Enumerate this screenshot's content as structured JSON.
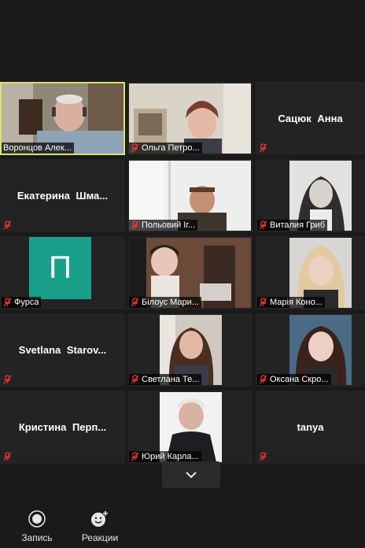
{
  "participants": [
    {
      "name": "Воронцов Алек...",
      "muted": false,
      "video": true
    },
    {
      "name": "Ольга Петро...",
      "muted": true,
      "video": true
    },
    {
      "name": "Сацюк Анна",
      "muted": true,
      "video": false
    },
    {
      "name": "Екатерина Шма...",
      "muted": true,
      "video": false
    },
    {
      "name": "Польовий Іг...",
      "muted": true,
      "video": true
    },
    {
      "name": "Виталия Гриб",
      "muted": true,
      "video": true
    },
    {
      "name": "Фурса",
      "muted": true,
      "video": false,
      "avatar_letter": "П",
      "avatar_color": "#19a08a"
    },
    {
      "name": "Білоус Мари...",
      "muted": true,
      "video": true
    },
    {
      "name": "Марія Коно...",
      "muted": true,
      "video": true
    },
    {
      "name": "Svetlana Starov...",
      "muted": true,
      "video": false
    },
    {
      "name": "Светлана Те...",
      "muted": true,
      "video": true
    },
    {
      "name": "Оксана Скро...",
      "muted": true,
      "video": true
    },
    {
      "name": "Кристина Перп...",
      "muted": true,
      "video": false
    },
    {
      "name": "Юрий Карла...",
      "muted": true,
      "video": true
    },
    {
      "name": "tanya",
      "muted": true,
      "video": false
    }
  ],
  "active_speaker_color": "#d8e36c",
  "toolbar": {
    "record_label": "Запись",
    "reactions_label": "Реакции",
    "more_icon": "chevron-down-icon"
  }
}
